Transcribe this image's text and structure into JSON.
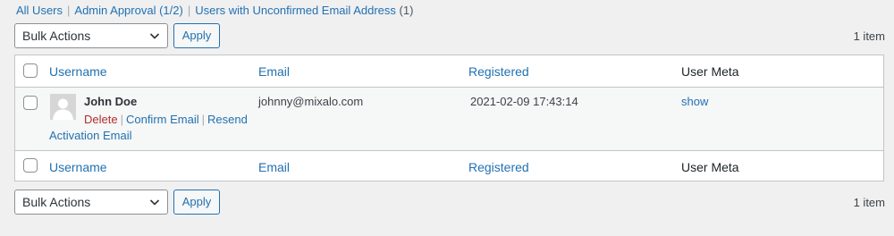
{
  "views": {
    "all_users": "All Users",
    "separator": "|",
    "admin_approval": "Admin Approval (1/2)",
    "unconfirmed": "Users with Unconfirmed Email Address",
    "unconfirmed_count": "(1)"
  },
  "top_nav": {
    "bulk_actions": "Bulk Actions",
    "apply": "Apply",
    "items_count": "1 item"
  },
  "bottom_nav": {
    "bulk_actions": "Bulk Actions",
    "apply": "Apply",
    "items_count": "1 item"
  },
  "columns": {
    "username": "Username",
    "email": "Email",
    "registered": "Registered",
    "user_meta": "User Meta"
  },
  "rows": [
    {
      "name": "John Doe",
      "actions": {
        "delete": "Delete",
        "confirm_email": "Confirm Email",
        "resend": "Resend Activation Email"
      },
      "email": "johnny@mixalo.com",
      "registered": "2021-02-09 17:43:14",
      "user_meta": "show"
    }
  ],
  "colors": {
    "link": "#2271b1",
    "delete": "#b32d2e",
    "background": "#f0f0f1",
    "border": "#c3c4c7"
  },
  "icons": {
    "avatar": "default-avatar-icon",
    "dropdown": "chevron-down-icon"
  }
}
